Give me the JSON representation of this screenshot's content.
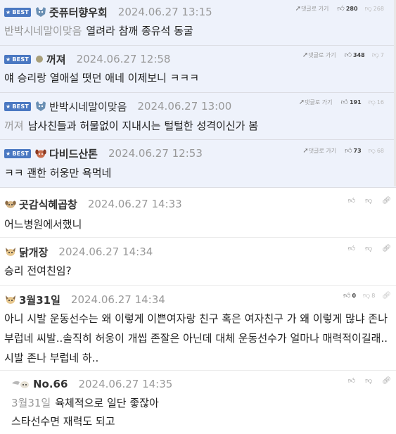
{
  "comments": [
    {
      "best": true,
      "badge": "BEST",
      "author": "줏퓨터향우회",
      "date": "2024.06.27 13:15",
      "reply_label": "댓글로 가기",
      "likes": "280",
      "dislikes": "268",
      "mention": "반박시네말이맞음",
      "text": "열려라 참깨 종유석 동굴",
      "icon": "cat-icon"
    },
    {
      "best": true,
      "badge": "BEST",
      "author": "꺼져",
      "date": "2024.06.27 12:58",
      "reply_label": "댓글로 가기",
      "likes": "348",
      "dislikes": "7",
      "text": "얘 승리랑 열애설 떳던 애네 이제보니 ㅋㅋㅋ",
      "icon": "dot-icon"
    },
    {
      "best": true,
      "badge": "BEST",
      "author": "반박시네말이맞음",
      "date": "2024.06.27 13:00",
      "reply_label": "댓글로 가기",
      "likes": "191",
      "dislikes": "16",
      "mention": "꺼져",
      "text": "남사친들과 허물없이 지내시는 털털한 성격이신가 봄",
      "icon": "cat-icon"
    },
    {
      "best": true,
      "badge": "BEST",
      "author": "다비드산톤",
      "date": "2024.06.27 12:53",
      "reply_label": "댓글로 가기",
      "likes": "73",
      "dislikes": "68",
      "text": "ㅋㅋ 괜한 허웅만 욕먹네",
      "icon": "dog-icon"
    },
    {
      "author": "곳감식혜곱창",
      "date": "2024.06.27 14:33",
      "text": "어느병원에서했니",
      "icon": "dog-icon"
    },
    {
      "author": "닭개장",
      "date": "2024.06.27 14:34",
      "text": "승리 전여친임?",
      "icon": "dog-icon"
    },
    {
      "author": "3월31일",
      "date": "2024.06.27 14:34",
      "likes": "0",
      "dislikes": "8",
      "text": "아니 시발 운동선수는 왜 이렇게 이쁜여자랑 친구 혹은 여자친구 가 왜 이렇게 많냐 존나 부럽네 씨발..솔직히 허웅이 개씹 존잘은 아닌데 대체 운동선수가 얼마나 매력적이길래..시발 존나 부럽네 하..",
      "icon": "dog-icon"
    },
    {
      "author": "No.66",
      "date": "2024.06.27 14:35",
      "mention": "3월31일",
      "text": "육체적으로 일단 좋잖아",
      "text2": "스타선수면 재력도 되고",
      "icon": "dog-icon"
    }
  ],
  "icons": {
    "like": "thumbs-up-icon",
    "dislike": "thumbs-down-icon",
    "share": "link-icon",
    "reply": "arrow-icon"
  },
  "colors": {
    "best_bg": "#eef2fb",
    "badge": "#4a78c2",
    "date": "#999999"
  }
}
